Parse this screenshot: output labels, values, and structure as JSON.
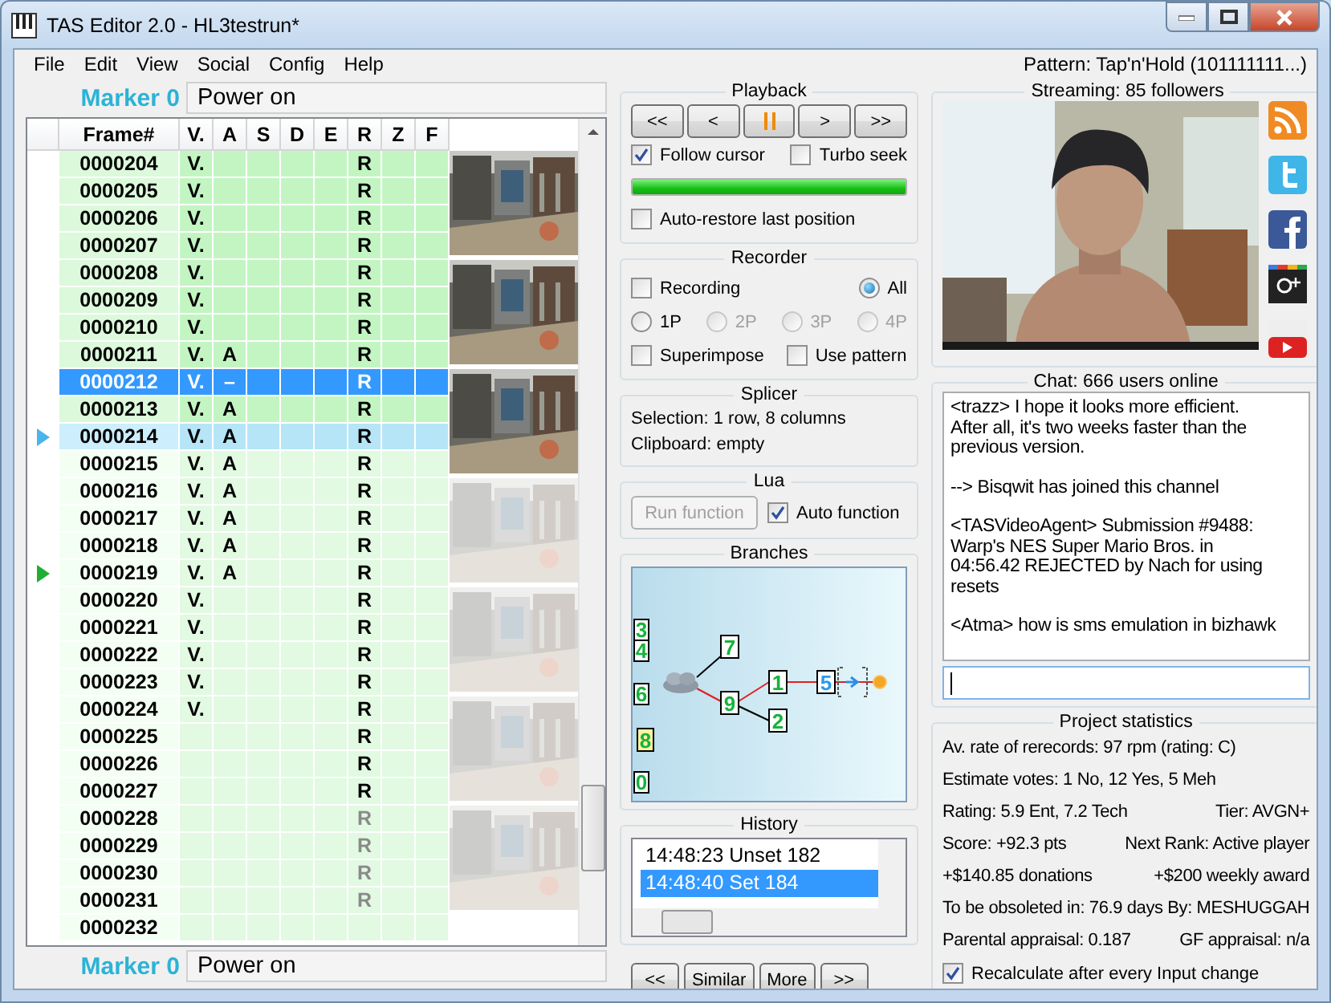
{
  "window": {
    "title": "TAS Editor 2.0 - HL3testrun*"
  },
  "menu": [
    "File",
    "Edit",
    "View",
    "Social",
    "Config",
    "Help"
  ],
  "pattern": "Pattern: Tap'n'Hold (101111111...)",
  "top_marker": {
    "label": "Marker 0",
    "note": "Power on"
  },
  "piano_roll": {
    "frame_header": "Frame#",
    "columns": [
      "V.",
      "A",
      "S",
      "D",
      "E",
      "R",
      "Z",
      "F"
    ],
    "rows": [
      {
        "frame": "0000204",
        "inputs": {
          "v": "V.",
          "r": "R"
        },
        "greenzone": true,
        "selected": false,
        "playback": false,
        "target": false,
        "greyed": false
      },
      {
        "frame": "0000205",
        "inputs": {
          "v": "V.",
          "r": "R"
        },
        "greenzone": true,
        "selected": false,
        "playback": false,
        "target": false,
        "greyed": false
      },
      {
        "frame": "0000206",
        "inputs": {
          "v": "V.",
          "r": "R"
        },
        "greenzone": true,
        "selected": false,
        "playback": false,
        "target": false,
        "greyed": false
      },
      {
        "frame": "0000207",
        "inputs": {
          "v": "V.",
          "r": "R"
        },
        "greenzone": true,
        "selected": false,
        "playback": false,
        "target": false,
        "greyed": false
      },
      {
        "frame": "0000208",
        "inputs": {
          "v": "V.",
          "r": "R"
        },
        "greenzone": true,
        "selected": false,
        "playback": false,
        "target": false,
        "greyed": false
      },
      {
        "frame": "0000209",
        "inputs": {
          "v": "V.",
          "r": "R"
        },
        "greenzone": true,
        "selected": false,
        "playback": false,
        "target": false,
        "greyed": false
      },
      {
        "frame": "0000210",
        "inputs": {
          "v": "V.",
          "r": "R"
        },
        "greenzone": true,
        "selected": false,
        "playback": false,
        "target": false,
        "greyed": false
      },
      {
        "frame": "0000211",
        "inputs": {
          "v": "V.",
          "a": "A",
          "r": "R"
        },
        "greenzone": true,
        "selected": false,
        "playback": false,
        "target": false,
        "greyed": false
      },
      {
        "frame": "0000212",
        "inputs": {
          "v": "V.",
          "a": "–",
          "r": "R"
        },
        "greenzone": true,
        "selected": true,
        "playback": false,
        "target": false,
        "greyed": false
      },
      {
        "frame": "0000213",
        "inputs": {
          "v": "V.",
          "a": "A",
          "r": "R"
        },
        "greenzone": true,
        "selected": false,
        "playback": false,
        "target": false,
        "greyed": false
      },
      {
        "frame": "0000214",
        "inputs": {
          "v": "V.",
          "a": "A",
          "r": "R"
        },
        "greenzone": true,
        "selected": false,
        "playback": true,
        "target": false,
        "greyed": false
      },
      {
        "frame": "0000215",
        "inputs": {
          "v": "V.",
          "a": "A",
          "r": "R"
        },
        "greenzone": false,
        "selected": false,
        "playback": false,
        "target": false,
        "greyed": false
      },
      {
        "frame": "0000216",
        "inputs": {
          "v": "V.",
          "a": "A",
          "r": "R"
        },
        "greenzone": false,
        "selected": false,
        "playback": false,
        "target": false,
        "greyed": false
      },
      {
        "frame": "0000217",
        "inputs": {
          "v": "V.",
          "a": "A",
          "r": "R"
        },
        "greenzone": false,
        "selected": false,
        "playback": false,
        "target": false,
        "greyed": false
      },
      {
        "frame": "0000218",
        "inputs": {
          "v": "V.",
          "a": "A",
          "r": "R"
        },
        "greenzone": false,
        "selected": false,
        "playback": false,
        "target": false,
        "greyed": false
      },
      {
        "frame": "0000219",
        "inputs": {
          "v": "V.",
          "a": "A",
          "r": "R"
        },
        "greenzone": false,
        "selected": false,
        "playback": false,
        "target": true,
        "greyed": false
      },
      {
        "frame": "0000220",
        "inputs": {
          "v": "V.",
          "r": "R"
        },
        "greenzone": false,
        "selected": false,
        "playback": false,
        "target": false,
        "greyed": false
      },
      {
        "frame": "0000221",
        "inputs": {
          "v": "V.",
          "r": "R"
        },
        "greenzone": false,
        "selected": false,
        "playback": false,
        "target": false,
        "greyed": false
      },
      {
        "frame": "0000222",
        "inputs": {
          "v": "V.",
          "r": "R"
        },
        "greenzone": false,
        "selected": false,
        "playback": false,
        "target": false,
        "greyed": false
      },
      {
        "frame": "0000223",
        "inputs": {
          "v": "V.",
          "r": "R"
        },
        "greenzone": false,
        "selected": false,
        "playback": false,
        "target": false,
        "greyed": false
      },
      {
        "frame": "0000224",
        "inputs": {
          "v": "V.",
          "r": "R"
        },
        "greenzone": false,
        "selected": false,
        "playback": false,
        "target": false,
        "greyed": false
      },
      {
        "frame": "0000225",
        "inputs": {
          "r": "R"
        },
        "greenzone": false,
        "selected": false,
        "playback": false,
        "target": false,
        "greyed": false
      },
      {
        "frame": "0000226",
        "inputs": {
          "r": "R"
        },
        "greenzone": false,
        "selected": false,
        "playback": false,
        "target": false,
        "greyed": false
      },
      {
        "frame": "0000227",
        "inputs": {
          "r": "R"
        },
        "greenzone": false,
        "selected": false,
        "playback": false,
        "target": false,
        "greyed": false
      },
      {
        "frame": "0000228",
        "inputs": {
          "r": "R"
        },
        "greenzone": false,
        "selected": false,
        "playback": false,
        "target": false,
        "greyed": true
      },
      {
        "frame": "0000229",
        "inputs": {
          "r": "R"
        },
        "greenzone": false,
        "selected": false,
        "playback": false,
        "target": false,
        "greyed": true
      },
      {
        "frame": "0000230",
        "inputs": {
          "r": "R"
        },
        "greenzone": false,
        "selected": false,
        "playback": false,
        "target": false,
        "greyed": true
      },
      {
        "frame": "0000231",
        "inputs": {
          "r": "R"
        },
        "greenzone": false,
        "selected": false,
        "playback": false,
        "target": false,
        "greyed": true
      },
      {
        "frame": "0000232",
        "greenzone": false,
        "selected": false,
        "playback": false,
        "target": false
      }
    ],
    "thumbnails": [
      {
        "faded": false
      },
      {
        "faded": false
      },
      {
        "faded": false
      },
      {
        "faded": true
      },
      {
        "faded": true
      },
      {
        "faded": true
      },
      {
        "faded": true
      }
    ]
  },
  "bottom_marker": {
    "label": "Marker 0",
    "note": "Power on"
  },
  "playback": {
    "title": "Playback",
    "buttons": [
      {
        "kind": "text",
        "label": "<<"
      },
      {
        "kind": "text",
        "label": "<"
      },
      {
        "kind": "pause"
      },
      {
        "kind": "text",
        "label": ">"
      },
      {
        "kind": "text",
        "label": ">>"
      }
    ],
    "follow_cursor": {
      "label": "Follow cursor",
      "checked": true
    },
    "turbo_seek": {
      "label": "Turbo seek",
      "checked": false
    },
    "progress": {
      "level": 1.0
    },
    "auto_restore": {
      "label": "Auto-restore last position",
      "checked": false
    }
  },
  "recorder": {
    "title": "Recorder",
    "recording": {
      "label": "Recording",
      "checked": false
    },
    "players": [
      {
        "label": "All",
        "selected": true,
        "disabled": false
      },
      {
        "label": "1P",
        "selected": false,
        "disabled": false
      },
      {
        "label": "2P",
        "selected": false,
        "disabled": true
      },
      {
        "label": "3P",
        "selected": false,
        "disabled": true
      },
      {
        "label": "4P",
        "selected": false,
        "disabled": true
      }
    ],
    "superimpose": {
      "label": "Superimpose",
      "checked": false
    },
    "use_pattern": {
      "label": "Use pattern",
      "checked": false
    }
  },
  "splicer": {
    "title": "Splicer",
    "selection": "Selection: 1 row, 8 columns",
    "clipboard": "Clipboard: empty"
  },
  "lua": {
    "title": "Lua",
    "run_button": {
      "label": "Run function",
      "disabled": true
    },
    "auto_function": {
      "label": "Auto function",
      "checked": true
    }
  },
  "branches": {
    "title": "Branches",
    "nodes": [
      {
        "label": "3",
        "current": false,
        "highlighted": false
      },
      {
        "label": "4",
        "current": false,
        "highlighted": false
      },
      {
        "label": "6",
        "current": false,
        "highlighted": false
      },
      {
        "label": "8",
        "current": false,
        "highlighted": true
      },
      {
        "label": "0",
        "current": false,
        "highlighted": false
      },
      {
        "label": "7",
        "current": false,
        "highlighted": false
      },
      {
        "label": "9",
        "current": false,
        "highlighted": false
      },
      {
        "label": "1",
        "current": false,
        "highlighted": false
      },
      {
        "label": "2",
        "current": false,
        "highlighted": false
      },
      {
        "label": "5",
        "current": true,
        "highlighted": false
      }
    ]
  },
  "history": {
    "title": "History",
    "items": [
      {
        "text": "14:48:23 Unset 182",
        "selected": false
      },
      {
        "text": "14:48:40 Set 184",
        "selected": true
      }
    ]
  },
  "bottom_buttons": [
    "<<",
    "Similar",
    "More",
    ">>"
  ],
  "streaming": {
    "title": "Streaming: 85 followers"
  },
  "chat": {
    "title": "Chat: 666 users online",
    "messages": [
      "<trazz> I hope it looks more efficient. After all, it's two weeks faster than the previous version.",
      "--> Bisqwit has joined this channel",
      "<TASVideoAgent> Submission #9488: Warp's NES Super Mario Bros. in 04:56.42 REJECTED by Nach for using resets",
      "<Atma> how is sms emulation in bizhawk"
    ]
  },
  "statistics": {
    "title": "Project statistics",
    "rows": [
      {
        "left": "Av. rate of rerecords: 97 rpm (rating: C)"
      },
      {
        "left": "Estimate votes: 1 No, 12 Yes, 5 Meh"
      },
      {
        "left": "Rating: 5.9 Ent, 7.2 Tech",
        "right": "Tier: AVGN+"
      },
      {
        "left": "Score: +92.3 pts",
        "right": "Next Rank: Active player"
      },
      {
        "left": "+$140.85 donations",
        "right": "+$200 weekly award"
      },
      {
        "left": "To be obsoleted in: 76.9 days By: MESHUGGAH"
      },
      {
        "left": "Parental appraisal: 0.187",
        "right": "GF appraisal: n/a"
      }
    ],
    "recalculate": {
      "label": "Recalculate after every Input change",
      "checked": true
    }
  }
}
